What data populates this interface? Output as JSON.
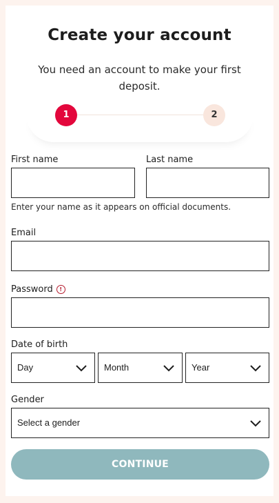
{
  "header": {
    "title": "Create your account",
    "subtitle": "You need an account to make your first deposit."
  },
  "stepper": {
    "current": 1,
    "steps": [
      "1",
      "2"
    ]
  },
  "form": {
    "first_name": {
      "label": "First name",
      "value": ""
    },
    "last_name": {
      "label": "Last name",
      "value": ""
    },
    "name_hint": "Enter your name as it appears on official documents.",
    "email": {
      "label": "Email",
      "value": ""
    },
    "password": {
      "label": "Password",
      "value": "",
      "info_icon": "info-circle-icon"
    },
    "dob": {
      "label": "Date of birth",
      "day": "Day",
      "month": "Month",
      "year": "Year"
    },
    "gender": {
      "label": "Gender",
      "selected": "Select a gender"
    },
    "continue_label": "CONTINUE"
  },
  "colors": {
    "page_bg": "#fdf3ee",
    "step_active": "#e3073c",
    "step_inactive": "#f9e6dd",
    "button_disabled": "#8fb8bd",
    "info_icon": "#b4192c"
  }
}
